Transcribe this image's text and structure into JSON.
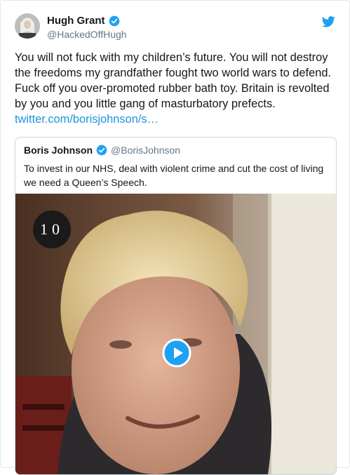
{
  "tweet": {
    "author_name": "Hugh Grant",
    "author_handle": "@HackedOffHugh",
    "text_main": "You will not fuck with my children’s future. You will not destroy the freedoms my grandfather fought two world wars to defend. Fuck off you over-promoted rubber bath toy. Britain is revolted by you and you little gang of masturbatory prefects.",
    "link_text": "twitter.com/borisjohnson/s…"
  },
  "quoted": {
    "author_name": "Boris Johnson",
    "author_handle": "@BorisJohnson",
    "text": "To invest in our NHS, deal with violent crime and cut the cost of living we need a Queen’s Speech.",
    "video_badge": "10"
  },
  "icons": {
    "verified": "verified-badge-icon",
    "bird": "twitter-bird-icon",
    "play": "play-icon"
  },
  "colors": {
    "accent": "#1da1f2",
    "link": "#1b95e0",
    "secondary_text": "#657786"
  }
}
